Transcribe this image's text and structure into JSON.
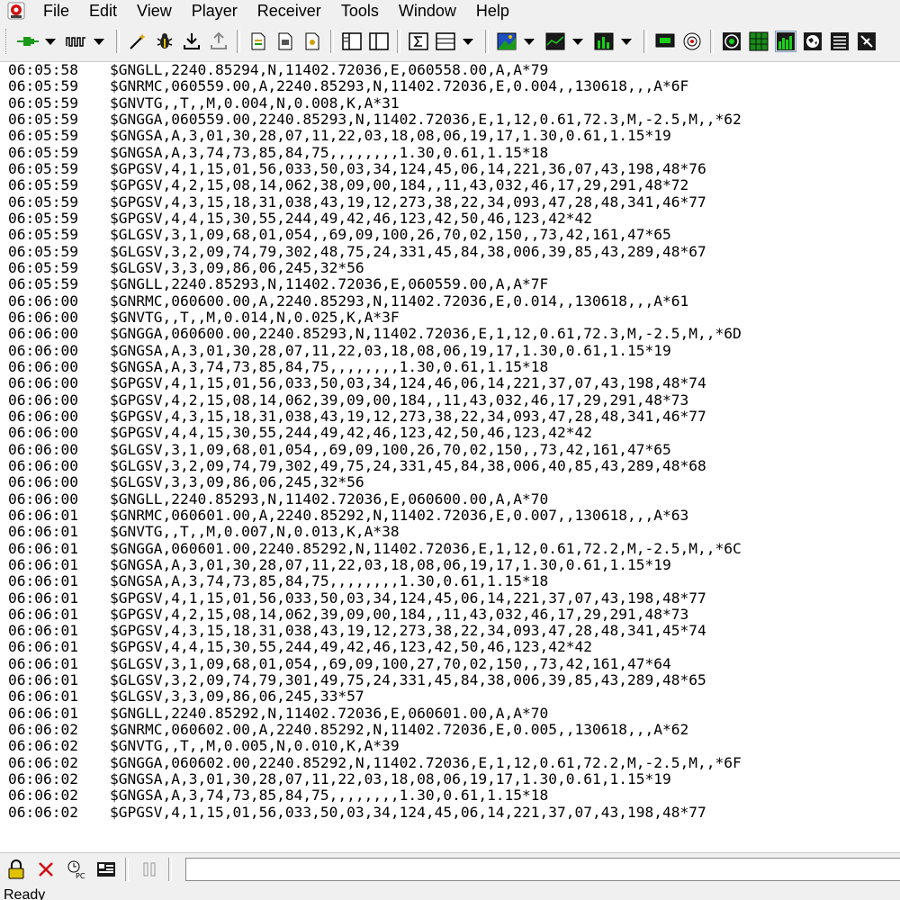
{
  "menu": [
    "File",
    "Edit",
    "View",
    "Player",
    "Receiver",
    "Tools",
    "Window",
    "Help"
  ],
  "log": [
    {
      "t": "06:05:58",
      "m": "$GNGLL,2240.85294,N,11402.72036,E,060558.00,A,A*79"
    },
    {
      "t": "06:05:59",
      "m": "$GNRMC,060559.00,A,2240.85293,N,11402.72036,E,0.004,,130618,,,A*6F"
    },
    {
      "t": "06:05:59",
      "m": "$GNVTG,,T,,M,0.004,N,0.008,K,A*31"
    },
    {
      "t": "06:05:59",
      "m": "$GNGGA,060559.00,2240.85293,N,11402.72036,E,1,12,0.61,72.3,M,-2.5,M,,*62"
    },
    {
      "t": "06:05:59",
      "m": "$GNGSA,A,3,01,30,28,07,11,22,03,18,08,06,19,17,1.30,0.61,1.15*19"
    },
    {
      "t": "06:05:59",
      "m": "$GNGSA,A,3,74,73,85,84,75,,,,,,,,1.30,0.61,1.15*18"
    },
    {
      "t": "06:05:59",
      "m": "$GPGSV,4,1,15,01,56,033,50,03,34,124,45,06,14,221,36,07,43,198,48*76"
    },
    {
      "t": "06:05:59",
      "m": "$GPGSV,4,2,15,08,14,062,38,09,00,184,,11,43,032,46,17,29,291,48*72"
    },
    {
      "t": "06:05:59",
      "m": "$GPGSV,4,3,15,18,31,038,43,19,12,273,38,22,34,093,47,28,48,341,46*77"
    },
    {
      "t": "06:05:59",
      "m": "$GPGSV,4,4,15,30,55,244,49,42,46,123,42,50,46,123,42*42"
    },
    {
      "t": "06:05:59",
      "m": "$GLGSV,3,1,09,68,01,054,,69,09,100,26,70,02,150,,73,42,161,47*65"
    },
    {
      "t": "06:05:59",
      "m": "$GLGSV,3,2,09,74,79,302,48,75,24,331,45,84,38,006,39,85,43,289,48*67"
    },
    {
      "t": "06:05:59",
      "m": "$GLGSV,3,3,09,86,06,245,32*56"
    },
    {
      "t": "06:05:59",
      "m": "$GNGLL,2240.85293,N,11402.72036,E,060559.00,A,A*7F"
    },
    {
      "t": "06:06:00",
      "m": "$GNRMC,060600.00,A,2240.85293,N,11402.72036,E,0.014,,130618,,,A*61"
    },
    {
      "t": "06:06:00",
      "m": "$GNVTG,,T,,M,0.014,N,0.025,K,A*3F"
    },
    {
      "t": "06:06:00",
      "m": "$GNGGA,060600.00,2240.85293,N,11402.72036,E,1,12,0.61,72.3,M,-2.5,M,,*6D"
    },
    {
      "t": "06:06:00",
      "m": "$GNGSA,A,3,01,30,28,07,11,22,03,18,08,06,19,17,1.30,0.61,1.15*19"
    },
    {
      "t": "06:06:00",
      "m": "$GNGSA,A,3,74,73,85,84,75,,,,,,,,1.30,0.61,1.15*18"
    },
    {
      "t": "06:06:00",
      "m": "$GPGSV,4,1,15,01,56,033,50,03,34,124,46,06,14,221,37,07,43,198,48*74"
    },
    {
      "t": "06:06:00",
      "m": "$GPGSV,4,2,15,08,14,062,39,09,00,184,,11,43,032,46,17,29,291,48*73"
    },
    {
      "t": "06:06:00",
      "m": "$GPGSV,4,3,15,18,31,038,43,19,12,273,38,22,34,093,47,28,48,341,46*77"
    },
    {
      "t": "06:06:00",
      "m": "$GPGSV,4,4,15,30,55,244,49,42,46,123,42,50,46,123,42*42"
    },
    {
      "t": "06:06:00",
      "m": "$GLGSV,3,1,09,68,01,054,,69,09,100,26,70,02,150,,73,42,161,47*65"
    },
    {
      "t": "06:06:00",
      "m": "$GLGSV,3,2,09,74,79,302,49,75,24,331,45,84,38,006,40,85,43,289,48*68"
    },
    {
      "t": "06:06:00",
      "m": "$GLGSV,3,3,09,86,06,245,32*56"
    },
    {
      "t": "06:06:00",
      "m": "$GNGLL,2240.85293,N,11402.72036,E,060600.00,A,A*70"
    },
    {
      "t": "06:06:01",
      "m": "$GNRMC,060601.00,A,2240.85292,N,11402.72036,E,0.007,,130618,,,A*63"
    },
    {
      "t": "06:06:01",
      "m": "$GNVTG,,T,,M,0.007,N,0.013,K,A*38"
    },
    {
      "t": "06:06:01",
      "m": "$GNGGA,060601.00,2240.85292,N,11402.72036,E,1,12,0.61,72.2,M,-2.5,M,,*6C"
    },
    {
      "t": "06:06:01",
      "m": "$GNGSA,A,3,01,30,28,07,11,22,03,18,08,06,19,17,1.30,0.61,1.15*19"
    },
    {
      "t": "06:06:01",
      "m": "$GNGSA,A,3,74,73,85,84,75,,,,,,,,1.30,0.61,1.15*18"
    },
    {
      "t": "06:06:01",
      "m": "$GPGSV,4,1,15,01,56,033,50,03,34,124,45,06,14,221,37,07,43,198,48*77"
    },
    {
      "t": "06:06:01",
      "m": "$GPGSV,4,2,15,08,14,062,39,09,00,184,,11,43,032,46,17,29,291,48*73"
    },
    {
      "t": "06:06:01",
      "m": "$GPGSV,4,3,15,18,31,038,43,19,12,273,38,22,34,093,47,28,48,341,45*74"
    },
    {
      "t": "06:06:01",
      "m": "$GPGSV,4,4,15,30,55,244,49,42,46,123,42,50,46,123,42*42"
    },
    {
      "t": "06:06:01",
      "m": "$GLGSV,3,1,09,68,01,054,,69,09,100,27,70,02,150,,73,42,161,47*64"
    },
    {
      "t": "06:06:01",
      "m": "$GLGSV,3,2,09,74,79,301,49,75,24,331,45,84,38,006,39,85,43,289,48*65"
    },
    {
      "t": "06:06:01",
      "m": "$GLGSV,3,3,09,86,06,245,33*57"
    },
    {
      "t": "06:06:01",
      "m": "$GNGLL,2240.85292,N,11402.72036,E,060601.00,A,A*70"
    },
    {
      "t": "06:06:02",
      "m": "$GNRMC,060602.00,A,2240.85292,N,11402.72036,E,0.005,,130618,,,A*62"
    },
    {
      "t": "06:06:02",
      "m": "$GNVTG,,T,,M,0.005,N,0.010,K,A*39"
    },
    {
      "t": "06:06:02",
      "m": "$GNGGA,060602.00,2240.85292,N,11402.72036,E,1,12,0.61,72.2,M,-2.5,M,,*6F"
    },
    {
      "t": "06:06:02",
      "m": "$GNGSA,A,3,01,30,28,07,11,22,03,18,08,06,19,17,1.30,0.61,1.15*19"
    },
    {
      "t": "06:06:02",
      "m": "$GNGSA,A,3,74,73,85,84,75,,,,,,,,1.30,0.61,1.15*18"
    },
    {
      "t": "06:06:02",
      "m": "$GPGSV,4,1,15,01,56,033,50,03,34,124,45,06,14,221,37,07,43,198,48*77"
    }
  ],
  "command_input": {
    "value": ""
  },
  "status": {
    "text": "Ready"
  },
  "icons": {
    "app": "u-center-app-icon",
    "accent_green": "#1a9a1a",
    "accent_red": "#d01010"
  }
}
